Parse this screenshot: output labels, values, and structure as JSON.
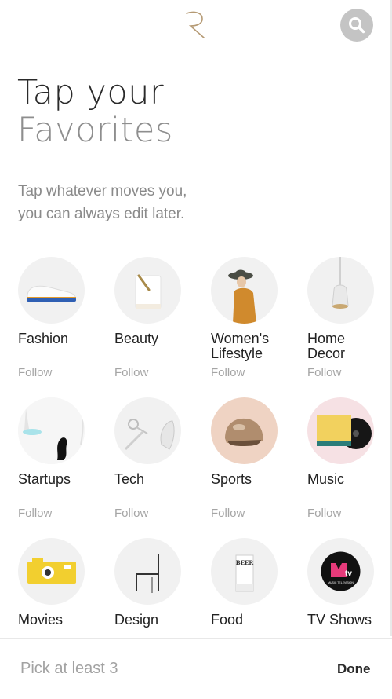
{
  "header": {
    "logo_icon": "r-logo-icon",
    "search_icon": "search-icon"
  },
  "intro": {
    "title_line1": "Tap your",
    "title_line2": "Favorites",
    "subtitle_line1": "Tap whatever moves you,",
    "subtitle_line2": "you can always edit later."
  },
  "categories": [
    {
      "label": "Fashion",
      "follow": "Follow",
      "icon": "shoe-icon"
    },
    {
      "label": "Beauty",
      "follow": "Follow",
      "icon": "cosmetic-jar-icon"
    },
    {
      "label": "Women's\nLifestyle",
      "follow": "Follow",
      "icon": "woman-hat-icon"
    },
    {
      "label": "Home\nDecor",
      "follow": "Follow",
      "icon": "pendant-lamp-icon"
    },
    {
      "label": "Startups",
      "follow": "Follow",
      "icon": "desk-lamp-icon"
    },
    {
      "label": "Tech",
      "follow": "Follow",
      "icon": "headphones-icon"
    },
    {
      "label": "Sports",
      "follow": "Follow",
      "icon": "helmet-icon"
    },
    {
      "label": "Music",
      "follow": "Follow",
      "icon": "vinyl-record-icon"
    },
    {
      "label": "Movies",
      "follow": "",
      "icon": "camera-icon"
    },
    {
      "label": "Design",
      "follow": "",
      "icon": "chair-icon"
    },
    {
      "label": "Food",
      "follow": "",
      "icon": "beer-glass-icon"
    },
    {
      "label": "TV Shows",
      "follow": "",
      "icon": "mtv-logo-icon"
    }
  ],
  "footer": {
    "pick_text": "Pick at least 3",
    "done_label": "Done"
  },
  "colors": {
    "accent_logo": "#b59a74",
    "search_bg": "#c4c4c4",
    "follow_text": "#a5a5a5"
  }
}
